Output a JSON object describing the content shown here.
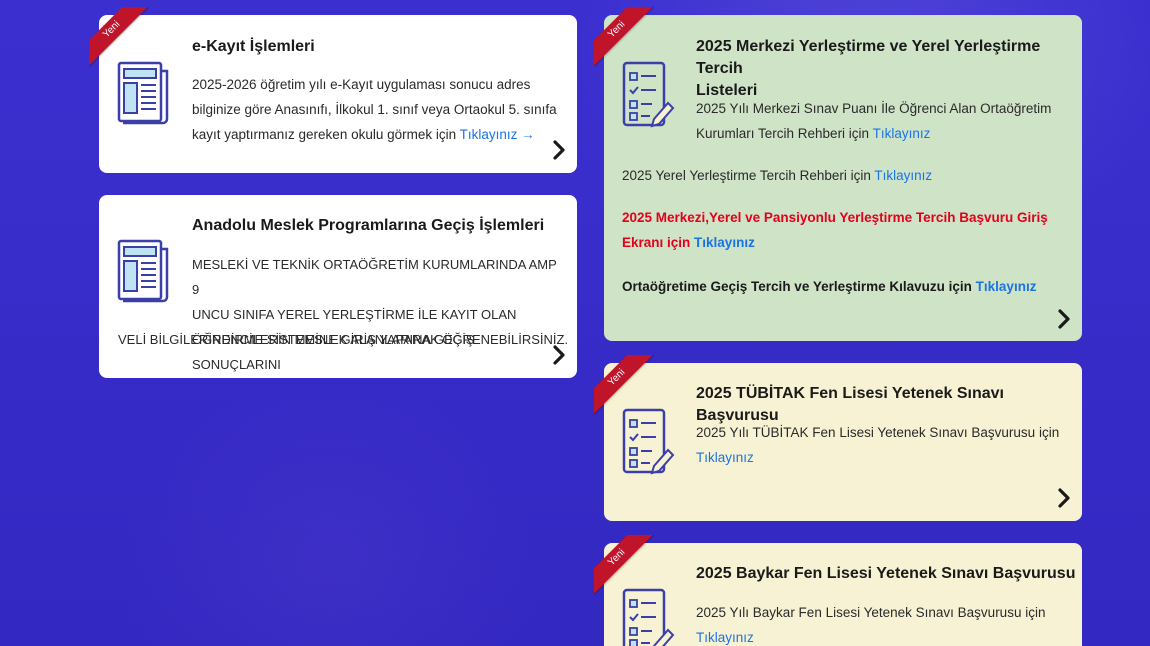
{
  "badge": "Yeni",
  "cards": {
    "ekayit": {
      "title": "e-Kayıt İşlemleri",
      "line1": "2025-2026 öğretim yılı e-Kayıt uygulaması sonucu adres",
      "line2": "bilginize göre Anasınıfı, İlkokul 1. sınıf veya Ortaokul 5. sınıfa",
      "line3": "kayıt yaptırmanız gereken okulu görmek için",
      "link": "Tıklayınız →"
    },
    "amp": {
      "title": "Anadolu Meslek Programlarına Geçiş İşlemleri",
      "line1": "MESLEKİ VE TEKNİK ORTAÖĞRETİM KURUMLARINDA AMP 9",
      "line2": "UNCU SINIFA YEREL YERLEŞTİRME İLE KAYIT OLAN",
      "line3": "ÖĞRENCİLERİN MESLEK ALANLARINA GEÇİŞ SONUÇLARINI",
      "line4": "VELİ BİLGİLERİNDİRME SİSTEMİNE GİRİŞ YAPARAK ÖĞRENEBİLİRSİNİZ."
    },
    "merkezi": {
      "title_line1": "2025 Merkezi Yerleştirme ve Yerel Yerleştirme Tercih",
      "title_line2": "Listeleri",
      "line1": "2025 Yılı Merkezi Sınav Puanı İle Öğrenci Alan Ortaöğretim",
      "line2": "Kurumları Tercih Rehberi için",
      "link1": "Tıklayınız",
      "line3": "2025 Yerel Yerleştirme Tercih Rehberi için",
      "link2": "Tıklayınız",
      "red_line1": "2025 Merkezi,Yerel ve Pansiyonlu Yerleştirme Tercih Başvuru Giriş",
      "red_line2": "Ekranı için",
      "link3": "Tıklayınız",
      "line4": "Ortaöğretime Geçiş Tercih ve Yerleştirme Kılavuzu için",
      "link4": "Tıklayınız"
    },
    "tubitak": {
      "title": "2025 TÜBİTAK Fen Lisesi Yetenek Sınavı Başvurusu",
      "line1": "2025 Yılı TÜBİTAK Fen Lisesi Yetenek Sınavı Başvurusu için",
      "link": "Tıklayınız"
    },
    "baykar": {
      "title": "2025 Baykar Fen Lisesi Yetenek Sınavı Başvurusu",
      "line1": "2025 Yılı Baykar Fen Lisesi Yetenek Sınavı Başvurusu için",
      "link": "Tıklayınız"
    }
  }
}
